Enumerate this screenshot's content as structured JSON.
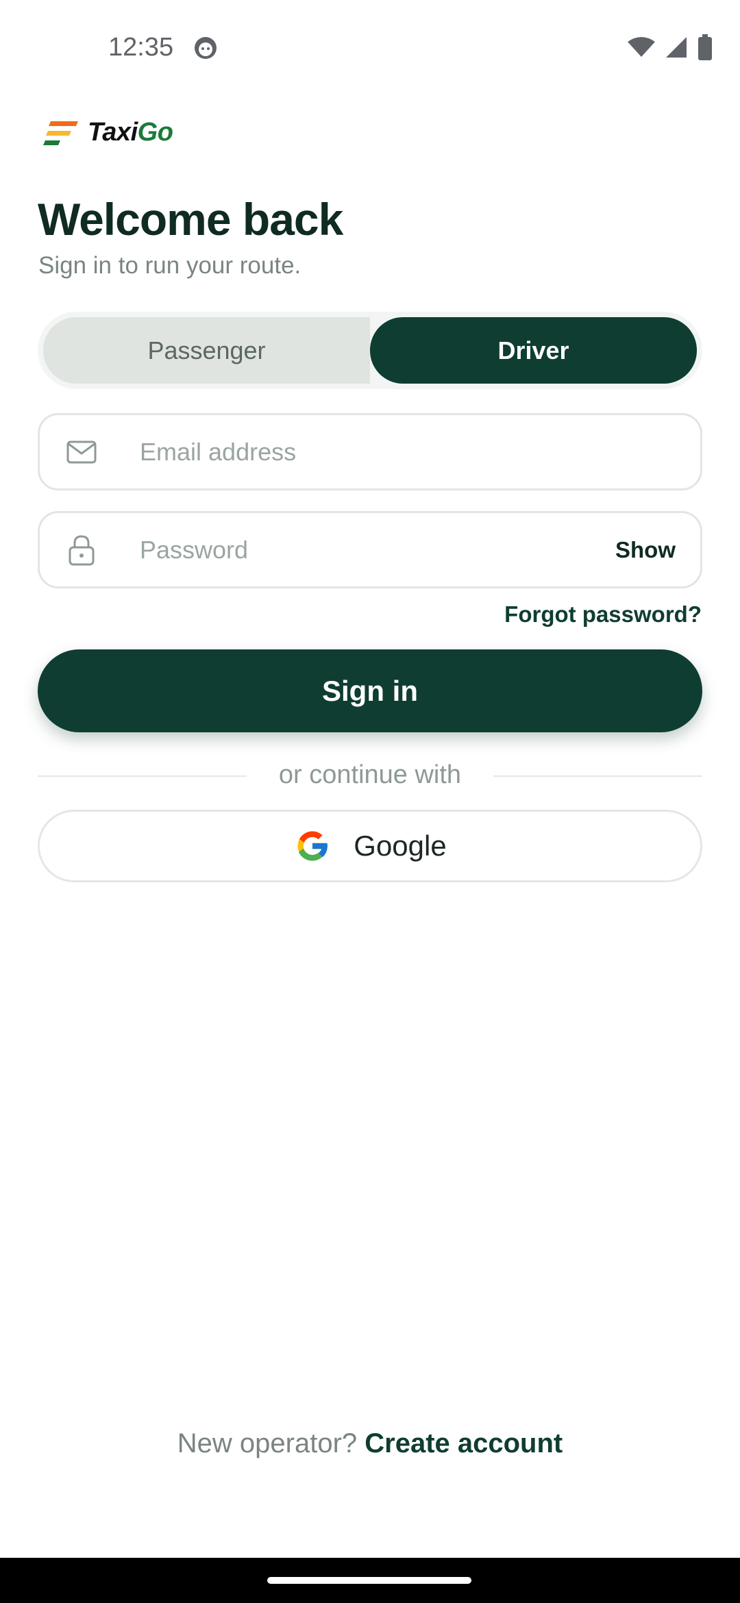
{
  "status_bar": {
    "time": "12:35",
    "icons": [
      "face-notification-icon",
      "wifi-icon",
      "signal-icon",
      "battery-icon"
    ]
  },
  "brand": {
    "name_part1": "Taxi",
    "name_part2": "Go",
    "colors": {
      "orange": "#f26a1b",
      "yellow": "#f5b82e",
      "green": "#1b7a3a"
    }
  },
  "header": {
    "title": "Welcome back",
    "subtitle": "Sign in to run your route."
  },
  "role_toggle": {
    "options": [
      {
        "label": "Passenger",
        "selected": false
      },
      {
        "label": "Driver",
        "selected": true
      }
    ]
  },
  "form": {
    "email": {
      "value": "",
      "placeholder": "Email address",
      "icon": "mail-icon"
    },
    "password": {
      "value": "",
      "placeholder": "Password",
      "icon": "lock-icon",
      "toggle_label": "Show"
    },
    "forgot_label": "Forgot password?",
    "submit_label": "Sign in"
  },
  "alt_login": {
    "divider_label": "or continue with",
    "google_label": "Google"
  },
  "footer": {
    "prefix": "New operator? ",
    "link_label": "Create account"
  },
  "theme": {
    "primary": "#0f3d31",
    "heading": "#0f2b22",
    "muted": "#7a8580",
    "border": "#e1e5e3"
  }
}
